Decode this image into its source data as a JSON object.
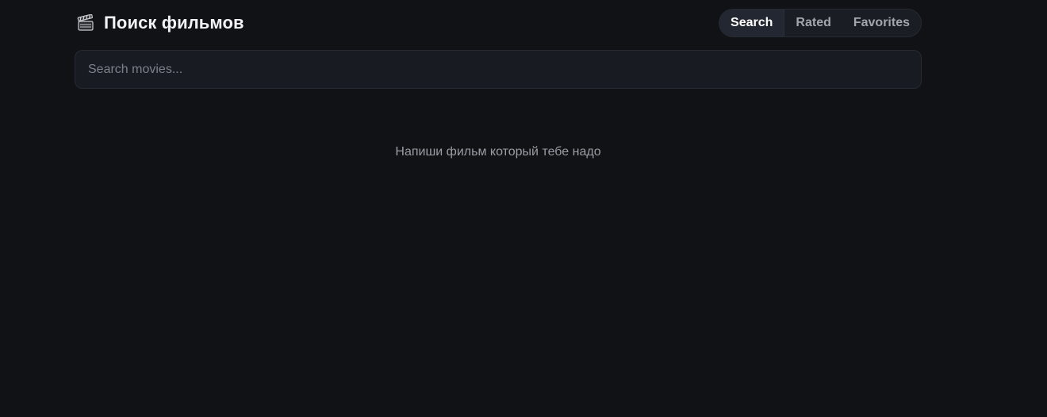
{
  "header": {
    "title": "Поиск фильмов",
    "icon": "clapperboard-icon"
  },
  "tabs": [
    {
      "label": "Search",
      "active": true
    },
    {
      "label": "Rated",
      "active": false
    },
    {
      "label": "Favorites",
      "active": false
    }
  ],
  "search": {
    "placeholder": "Search movies...",
    "value": ""
  },
  "main": {
    "empty_message": "Напиши фильм который тебе надо"
  },
  "colors": {
    "background": "#111215",
    "surface": "#191b22",
    "text": "#e6e7ea",
    "muted": "#9a9da5"
  }
}
